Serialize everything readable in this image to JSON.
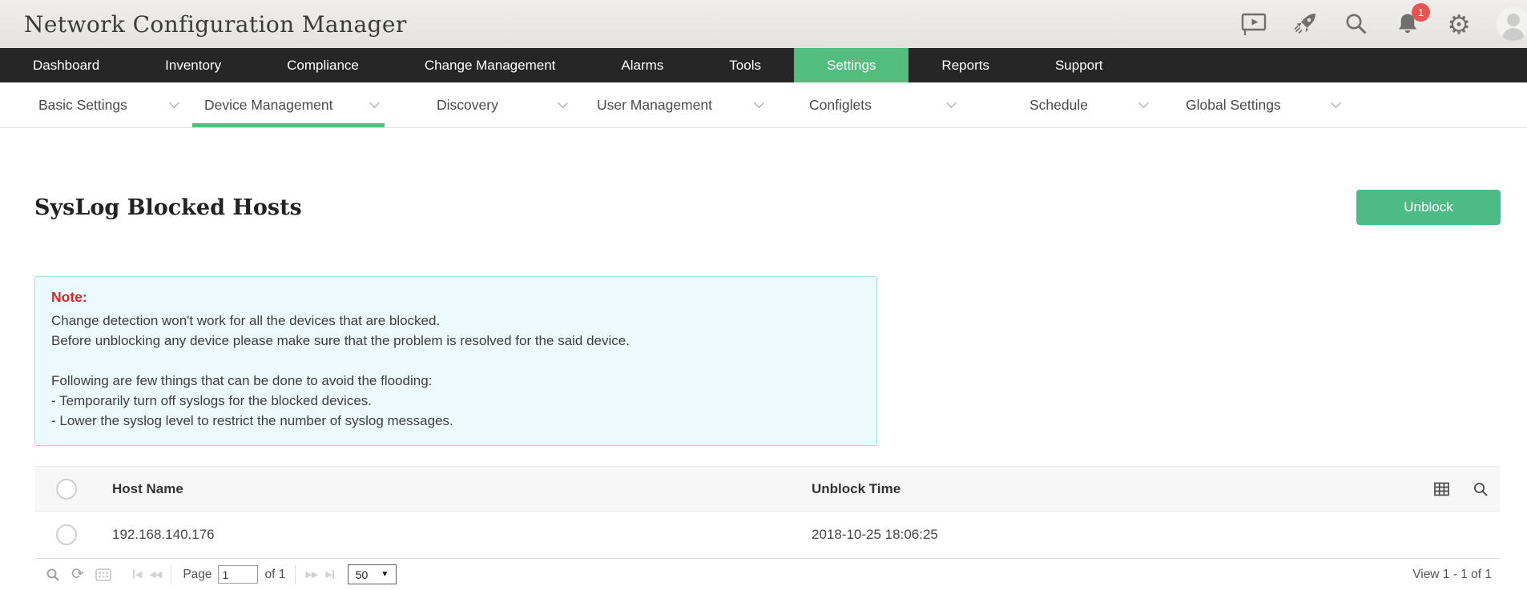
{
  "app": {
    "title": "Network Configuration Manager",
    "notification_count": "1",
    "header_icons": [
      "presentation-icon",
      "rocket-icon",
      "search-icon",
      "bell-icon",
      "gear-icon",
      "avatar"
    ]
  },
  "nav": {
    "items": [
      {
        "label": "Dashboard",
        "active": false
      },
      {
        "label": "Inventory",
        "active": false
      },
      {
        "label": "Compliance",
        "active": false
      },
      {
        "label": "Change Management",
        "active": false
      },
      {
        "label": "Alarms",
        "active": false
      },
      {
        "label": "Tools",
        "active": false
      },
      {
        "label": "Settings",
        "active": true
      },
      {
        "label": "Reports",
        "active": false
      },
      {
        "label": "Support",
        "active": false
      }
    ]
  },
  "subnav": {
    "items": [
      {
        "label": "Basic Settings",
        "active": false
      },
      {
        "label": "Device Management",
        "active": true
      },
      {
        "label": "Discovery",
        "active": false
      },
      {
        "label": "User Management",
        "active": false
      },
      {
        "label": "Configlets",
        "active": false
      },
      {
        "label": "Schedule",
        "active": false
      },
      {
        "label": "Global Settings",
        "active": false
      }
    ]
  },
  "page": {
    "title": "SysLog Blocked Hosts",
    "unblock_button": "Unblock"
  },
  "note": {
    "label": "Note:",
    "line1": "Change detection won't work for all the devices that are blocked.",
    "line2": "Before unblocking any device please make sure that the problem is resolved for the said device.",
    "line3": "Following are few things that can be done to avoid the flooding:",
    "line4": "- Temporarily turn off syslogs for the blocked devices.",
    "line5": "- Lower the syslog level to restrict the number of syslog messages."
  },
  "table": {
    "columns": {
      "host": "Host Name",
      "time": "Unblock Time"
    },
    "rows": [
      {
        "host": "192.168.140.176",
        "time": "2018-10-25 18:06:25"
      }
    ]
  },
  "pagination": {
    "page_label": "Page",
    "page_value": "1",
    "of_label": "of 1",
    "page_size": "50",
    "view_label": "View 1 - 1 of 1"
  },
  "colors": {
    "accent_green": "#4dbb85",
    "nav_active_green": "#53bd7e",
    "nav_bg": "#262626",
    "note_red": "#df2227",
    "note_border": "#a9dcec",
    "note_bg": "#ecfafd",
    "badge_red": "#e8544e"
  }
}
